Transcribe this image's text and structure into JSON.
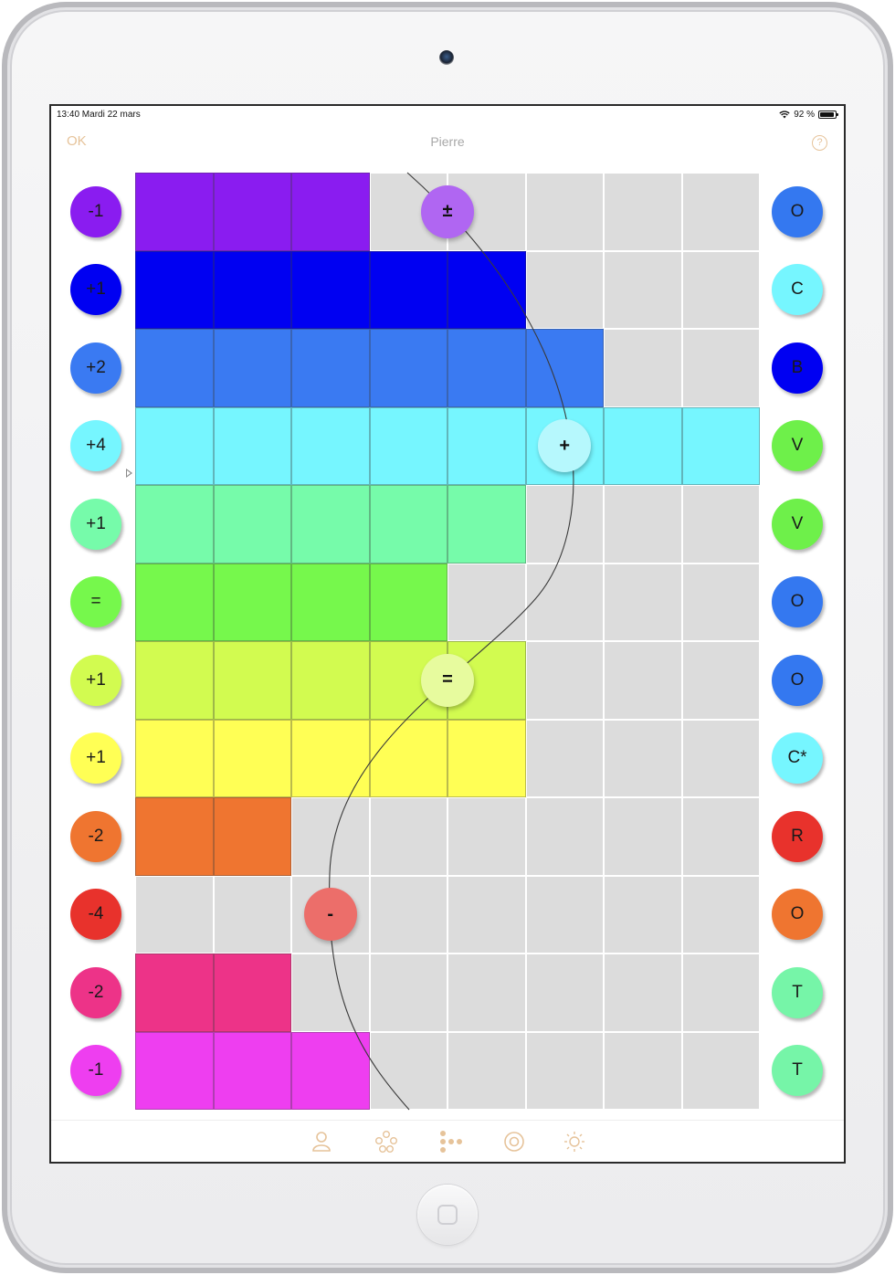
{
  "status_bar": {
    "time_date": "13:40  Mardi 22 mars",
    "battery_text": "92 %",
    "battery_level": 0.92
  },
  "nav": {
    "left_label": "OK",
    "title": "Pierre",
    "help_label": "?"
  },
  "colors": {
    "accent": "#e6c39a",
    "empty_cell": "#dcdcdc",
    "rows": [
      "#8a1cf0",
      "#0000f2",
      "#3a7af2",
      "#76f6ff",
      "#76fbaa",
      "#76f84c",
      "#d2fb50",
      "#ffff55",
      "#ef7530",
      "#e8322c",
      "#ed3388",
      "#ee3ef0"
    ]
  },
  "rows": [
    {
      "left_label": "-1",
      "left_color": "#8a1cf0",
      "filled": 3,
      "right_label": "O",
      "right_color": "#3478f0"
    },
    {
      "left_label": "+1",
      "left_color": "#0000f2",
      "filled": 5,
      "right_label": "C",
      "right_color": "#76f6ff"
    },
    {
      "left_label": "+2",
      "left_color": "#3a7af2",
      "filled": 6,
      "right_label": "B",
      "right_color": "#0000f2"
    },
    {
      "left_label": "+4",
      "left_color": "#76f6ff",
      "filled": 8,
      "right_label": "V",
      "right_color": "#6ef04a"
    },
    {
      "left_label": "+1",
      "left_color": "#76fbaa",
      "filled": 5,
      "right_label": "V",
      "right_color": "#6ef04a"
    },
    {
      "left_label": "=",
      "left_color": "#76f84c",
      "filled": 4,
      "right_label": "O",
      "right_color": "#3478f0"
    },
    {
      "left_label": "+1",
      "left_color": "#d2fb50",
      "filled": 5,
      "right_label": "O",
      "right_color": "#3478f0"
    },
    {
      "left_label": "+1",
      "left_color": "#ffff55",
      "filled": 5,
      "right_label": "C*",
      "right_color": "#76f6ff"
    },
    {
      "left_label": "-2",
      "left_color": "#ef7530",
      "filled": 2,
      "right_label": "R",
      "right_color": "#e8322c"
    },
    {
      "left_label": "-4",
      "left_color": "#e8322c",
      "filled": 0,
      "right_label": "O",
      "right_color": "#ef7530"
    },
    {
      "left_label": "-2",
      "left_color": "#ed3388",
      "filled": 2,
      "right_label": "T",
      "right_color": "#76f5a8"
    },
    {
      "left_label": "-1",
      "left_color": "#ee3ef0",
      "filled": 3,
      "right_label": "T",
      "right_color": "#76f5a8"
    }
  ],
  "markers": [
    {
      "label": "±",
      "row": 0,
      "col": 4,
      "color": "#b066f2"
    },
    {
      "label": "+",
      "row": 3,
      "col": 5.5,
      "color": "#b6f8fd"
    },
    {
      "label": "=",
      "row": 6,
      "col": 4,
      "color": "#e7fb9e"
    },
    {
      "label": "-",
      "row": 9,
      "col": 2.5,
      "color": "#ec6e6a"
    }
  ],
  "tabs": [
    {
      "name": "person-icon",
      "active": false
    },
    {
      "name": "circles-icon",
      "active": false
    },
    {
      "name": "dots-grid-icon",
      "active": true
    },
    {
      "name": "target-icon",
      "active": false
    },
    {
      "name": "sun-icon",
      "active": false
    }
  ]
}
